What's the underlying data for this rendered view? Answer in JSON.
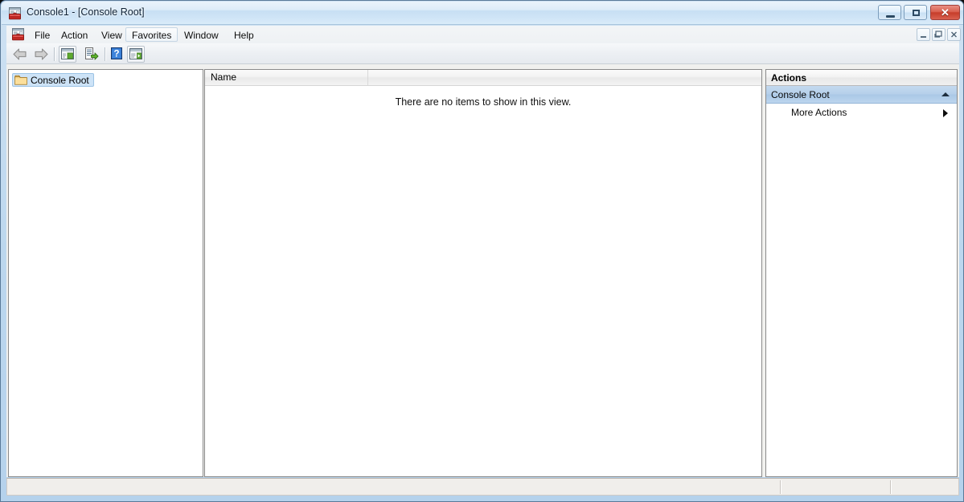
{
  "window": {
    "title": "Console1 - [Console Root]",
    "app_icon": "mmc-console-icon",
    "caption_buttons": {
      "minimize": "minimize-button",
      "maximize": "maximize-button",
      "close_label": "✕"
    },
    "mdi_buttons": {
      "minimize": "mdi-minimize-button",
      "restore_label": "❐",
      "close_label": "✕"
    }
  },
  "menu": {
    "icon": "mmc-console-icon",
    "items": [
      {
        "label": "File",
        "active": false
      },
      {
        "label": "Action",
        "active": false
      },
      {
        "label": "View",
        "active": false
      },
      {
        "label": "Favorites",
        "active": true
      },
      {
        "label": "Window",
        "active": false
      },
      {
        "label": "Help",
        "active": false
      }
    ]
  },
  "toolbar": {
    "buttons": [
      {
        "name": "back-button",
        "icon": "back-arrow-icon",
        "enabled": false
      },
      {
        "name": "forward-button",
        "icon": "forward-arrow-icon",
        "enabled": false
      },
      {
        "name": "show-console-tree-button",
        "icon": "console-tree-icon",
        "enabled": true
      },
      {
        "name": "export-list-button",
        "icon": "export-list-icon",
        "enabled": true
      },
      {
        "name": "help-button",
        "icon": "help-question-icon",
        "enabled": true
      },
      {
        "name": "show-action-pane-button",
        "icon": "action-pane-icon",
        "enabled": true
      }
    ]
  },
  "tree": {
    "nodes": [
      {
        "label": "Console Root",
        "icon": "folder-icon",
        "selected": true
      }
    ]
  },
  "list": {
    "columns": [
      {
        "label": "Name"
      },
      {
        "label": ""
      }
    ],
    "empty_message": "There are no items to show in this view.",
    "rows": []
  },
  "actions": {
    "title": "Actions",
    "group": {
      "label": "Console Root",
      "collapse_icon": "chevron-up-icon"
    },
    "items": [
      {
        "label": "More Actions",
        "submenu_icon": "submenu-arrow-icon"
      }
    ]
  },
  "status_bar": {
    "segments": [
      "",
      "",
      ""
    ]
  },
  "colors": {
    "frame": "#bcd7ee",
    "title_text": "#0d2135",
    "close_button": "#c63d2a",
    "tree_selection": "#cde3f7",
    "actions_group": "#b6d0ea",
    "pane_border": "#8a8a8a"
  }
}
